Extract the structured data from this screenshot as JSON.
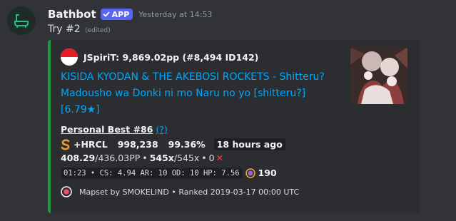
{
  "message": {
    "username": "Bathbot",
    "badge": "APP",
    "timestamp": "Yesterday at 14:53",
    "content": "Try #2",
    "edited": "(edited)"
  },
  "embed": {
    "accent_color": "#1e9a3c",
    "author": "JSpiriT: 9,869.02pp (#8,494 ID142)",
    "title": "KISIDA KYODAN & THE AKEBOSI ROCKETS - Shitteru? Madousho wa Donki ni mo Naru no yo [shitteru?] [6.79★]",
    "pb_title": "Personal Best #86",
    "pb_help": "(?)",
    "grade": "S",
    "mods": "+HRCL",
    "score": "998,238",
    "accuracy": "99.36%",
    "ago": "18 hours ago",
    "pp": "408.29",
    "pp_max": "/436.03PP",
    "combo": "545x",
    "combo_max": "/545x",
    "misses": "0",
    "map_stats": "01:23 • CS: 4.94 AR: 10 OD: 10 HP: 7.56",
    "bpm": "190",
    "footer": "Mapset by SMOKELIND • Ranked 2019-03-17 00:00 UTC"
  }
}
